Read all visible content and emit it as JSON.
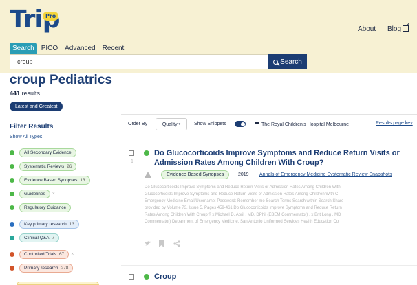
{
  "brand": {
    "logo": "Trip",
    "badge": "Pro"
  },
  "nav": {
    "about": "About",
    "blog": "Blog"
  },
  "tabs": [
    {
      "label": "Search",
      "active": true
    },
    {
      "label": "PICO",
      "active": false
    },
    {
      "label": "Advanced",
      "active": false
    },
    {
      "label": "Recent",
      "active": false
    }
  ],
  "search": {
    "value": "croup",
    "button": "Search"
  },
  "page": {
    "title": "croup Pediatrics",
    "count": "441",
    "count_suffix": "results",
    "latest_button": "Latest and Greatest"
  },
  "filters": {
    "heading": "Filter Results",
    "show_all": "Show All Types",
    "items": [
      {
        "label": "All Secondary Evidence",
        "count": "",
        "color": "#4db848"
      },
      {
        "label": "Systematic Reviews",
        "count": "26",
        "color": "#4db848"
      },
      {
        "label": "Evidence Based Synopses",
        "count": "13",
        "color": "#4db848"
      },
      {
        "label": "Guidelines",
        "count": "",
        "color": "#4db848"
      },
      {
        "label": "Regulatory Guidance",
        "count": "",
        "color": "#4db848"
      },
      {
        "label": "Key primary research",
        "count": "13",
        "color": "#2b6fc0"
      },
      {
        "label": "Clinical Q&A",
        "count": "7",
        "color": "#2aa79b"
      },
      {
        "label": "Controlled Trials",
        "count": "67",
        "color": "#d2542a"
      },
      {
        "label": "Primary research",
        "count": "278",
        "color": "#d2542a"
      }
    ]
  },
  "toolbar": {
    "order_by": "Order By",
    "order_value": "Quality",
    "show_snippets": "Show Snippets",
    "source": "The Royal Children's Hospital Melbourne",
    "results_key": "Results page key"
  },
  "results": [
    {
      "title_line1": "Do Glucocorticoids Improve Symptoms and Reduce Return Visits or",
      "title_line2": "Admission Rates Among Children With Croup?",
      "index": "1",
      "type": "Evidence Based Synopses",
      "year": "2019",
      "journal": "Annals of Emergency Medicine Systematic Review Snapshots",
      "snippet": [
        "Do Glucocorticoids Improve Symptoms and Reduce Return Visits or Admission Rates Among Children With",
        "Glucocorticoids Improve Symptoms and Reduce Return Visits or Admission Rates Among Children With C",
        "Emergency Medicine Email/Username: Password: Remember me Search Terms Search within Search Share",
        "provided by Volume 73, Issue 5, Pages 459-461 Do Glucocorticoids Improve Symptoms and Reduce Return",
        "Rates Among Children With  Croup ? x Michael D. April , MD, DPhil (EBEM Commentator) , x Brit Long , MD",
        "Commentator) Department of Emergency Medicine, San Antonio Uniformed Services Health Education Co"
      ]
    },
    {
      "title_line1": "Croup"
    }
  ],
  "icons": {
    "search": "search-icon",
    "external": "external-link-icon",
    "twitter": "twitter-icon",
    "bookmark": "bookmark-icon",
    "share": "share-icon",
    "pyramid": "evidence-pyramid-icon"
  }
}
